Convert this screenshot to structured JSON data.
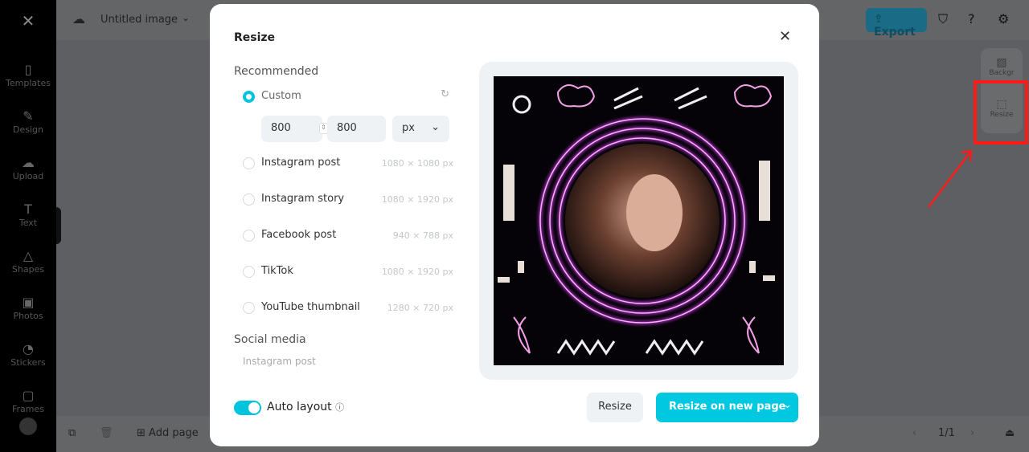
{
  "app": {
    "document_title": "Untitled image",
    "export_label": "Export"
  },
  "sidebar": {
    "items": [
      {
        "label": "Templates",
        "icon": "templates-icon"
      },
      {
        "label": "Design",
        "icon": "design-icon"
      },
      {
        "label": "Upload",
        "icon": "upload-icon"
      },
      {
        "label": "Text",
        "icon": "text-icon"
      },
      {
        "label": "Shapes",
        "icon": "shapes-icon"
      },
      {
        "label": "Photos",
        "icon": "photos-icon"
      },
      {
        "label": "Stickers",
        "icon": "stickers-icon"
      },
      {
        "label": "Frames",
        "icon": "frames-icon"
      }
    ]
  },
  "right_panel": {
    "items": [
      {
        "label": "Backgr"
      },
      {
        "label": "Resize"
      }
    ]
  },
  "bottom": {
    "add_page": "Add page",
    "page_indicator": "1/1"
  },
  "modal": {
    "title": "Resize",
    "recommended_label": "Recommended",
    "custom": {
      "label": "Custom",
      "width": "800",
      "height": "800",
      "unit": "px"
    },
    "options": [
      {
        "label": "Instagram post",
        "size": "1080 × 1080 px"
      },
      {
        "label": "Instagram story",
        "size": "1080 × 1920 px"
      },
      {
        "label": "Facebook post",
        "size": "940 × 788 px"
      },
      {
        "label": "TikTok",
        "size": "1080 × 1920 px"
      },
      {
        "label": "YouTube thumbnail",
        "size": "1280 × 720 px"
      }
    ],
    "social_media_label": "Social media",
    "social_first": "Instagram post",
    "auto_layout": {
      "label": "Auto layout",
      "enabled": true
    },
    "resize_button": "Resize",
    "resize_new_button": "Resize on new page"
  },
  "colors": {
    "accent": "#00c3dd",
    "highlight": "#ff1a1a",
    "neon": "#e040ff"
  }
}
